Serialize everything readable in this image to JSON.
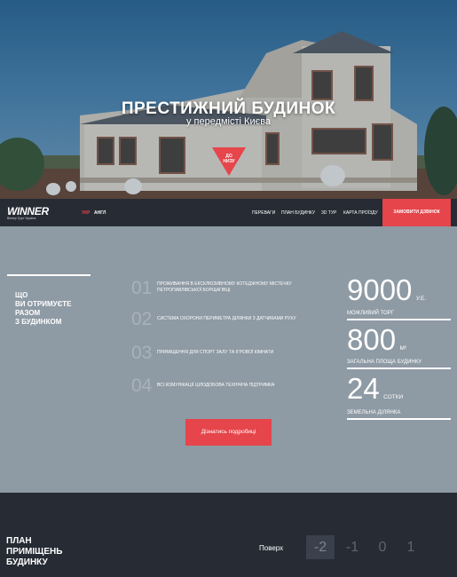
{
  "hero": {
    "title": "ПРЕСТИЖНИЙ БУДИНОК",
    "subtitle": "у передмісті Києва",
    "down_button_label_1": "ДО",
    "down_button_label_2": "НИЗУ"
  },
  "nav": {
    "logo_text": "WINNER",
    "logo_sub": "Віннер Груп Україна",
    "lang_ukr": "УКР",
    "lang_eng": "АНГЛ",
    "links": [
      "ПЕРЕВАГИ",
      "ПЛАН БУДИНКУ",
      "3D ТУР",
      "КАРТА ПРОЇЗДУ"
    ],
    "cta": "ЗАМОВИТИ ДЗВІНОК"
  },
  "benefits": {
    "title_lines": [
      "ЩО",
      "ВИ ОТРИМУЄТЕ",
      "РАЗОМ",
      "З БУДИНКОМ"
    ],
    "features": [
      {
        "num": "01",
        "text_1": "ПРОЖИВАННЯ В ЕКСКЛЮЗИВНОМУ КОТЕДЖНОМУ МІСТЕЧКУ",
        "text_2": "ПЕТРОПАВЛІВСЬКОЇ БОРЩАГІВЦІ"
      },
      {
        "num": "02",
        "text_1": "СИСТЕМА ОХОРОНИ ПЕРИМЕТРА ДІЛЯНКИ З ДАТЧИКАМИ РУХУ",
        "text_2": ""
      },
      {
        "num": "03",
        "text_1": "ПРИМІЩЕННЯ ДЛЯ СПОРТ ЗАЛУ ТА ІГРОВОЇ КІМНАТИ",
        "text_2": ""
      },
      {
        "num": "04",
        "text_1": "ВСІ КОМУНІКАЦІЇ ЦІЛОДОБОВА ТЕХНІЧНА ПІДТРИМКА",
        "text_2": ""
      }
    ],
    "more_button": "Дізнатись подробиці",
    "stats": [
      {
        "value": "9000",
        "unit": "У.Е.",
        "label": "МОЖЛИВИЙ ТОРГ"
      },
      {
        "value": "800",
        "unit": "М²",
        "label": "ЗАГАЛЬНА ПЛОЩА БУДИНКУ"
      },
      {
        "value": "24",
        "unit": "СОТКИ",
        "label": "ЗЕМЕЛЬНА ДІЛЯНКА"
      }
    ]
  },
  "plan": {
    "title_lines": [
      "ПЛАН",
      "ПРИМІЩЕНЬ",
      "БУДИНКУ"
    ],
    "floor_label": "Поверх",
    "floors": [
      "-2",
      "-1",
      "0",
      "1"
    ]
  },
  "colors": {
    "accent": "#e5454b",
    "dark": "#262b34",
    "slate": "#8e9aa4"
  }
}
